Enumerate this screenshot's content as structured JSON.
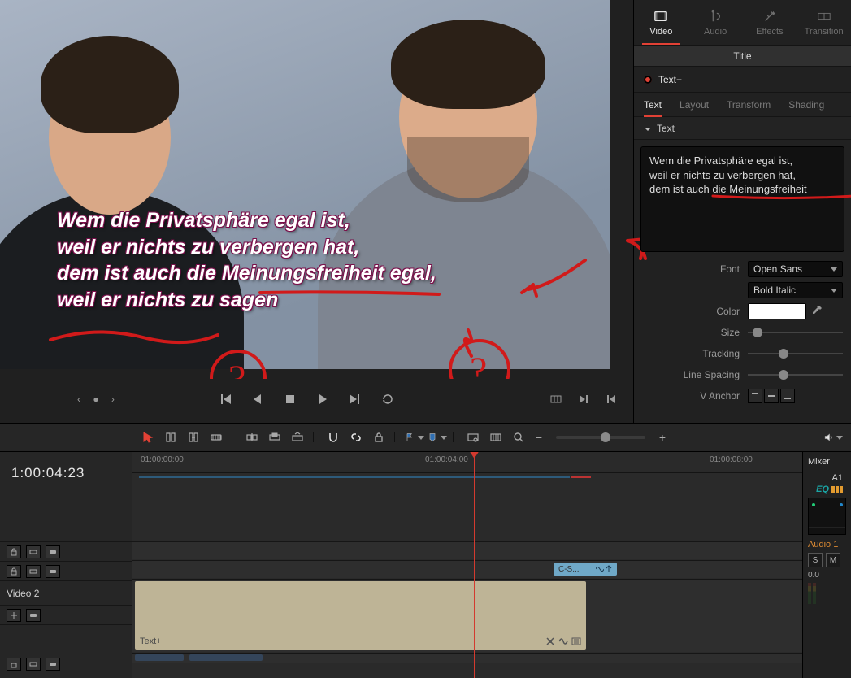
{
  "preview": {
    "caption_line1": "Wem die Privatsphäre egal ist,",
    "caption_line2": "weil er nichts zu verbergen hat,",
    "caption_line3": "dem ist auch die Meinungsfreiheit egal,",
    "caption_line4": "weil er nichts zu sagen",
    "annotation_marks": [
      "?",
      "?"
    ]
  },
  "inspector": {
    "tabs": {
      "video": "Video",
      "audio": "Audio",
      "effects": "Effects",
      "transition": "Transition"
    },
    "title_bar": "Title",
    "node_name": "Text+",
    "subtabs": {
      "text": "Text",
      "layout": "Layout",
      "transform": "Transform",
      "shading": "Shading"
    },
    "section_header": "Text",
    "text_value": "Wem die Privatsphäre egal ist,\nweil er nichts zu verbergen hat,\ndem ist auch die Meinungsfreiheit",
    "props": {
      "font_label": "Font",
      "font_value": "Open Sans",
      "weight_value": "Bold Italic",
      "color_label": "Color",
      "color_value": "#ffffff",
      "size_label": "Size",
      "tracking_label": "Tracking",
      "line_spacing_label": "Line Spacing",
      "vanchor_label": "V Anchor"
    }
  },
  "toolbar": {
    "markers": {
      "in_color": "#2f6fb3",
      "out_color": "#2f6fb3"
    }
  },
  "timeline": {
    "timecode": "1:00:04:23",
    "ruler": {
      "t0": "01:00:00:00",
      "t1": "01:00:04:00",
      "t2": "01:00:08:00"
    },
    "tracks": {
      "v2_label": "Video 2",
      "clip_cs": "C-S...",
      "clip_textplus": "Text+"
    }
  },
  "mixer": {
    "header": "Mixer",
    "a1": "A1",
    "eq": "EQ",
    "audio1": "Audio 1",
    "s": "S",
    "m": "M",
    "db": "0.0"
  }
}
